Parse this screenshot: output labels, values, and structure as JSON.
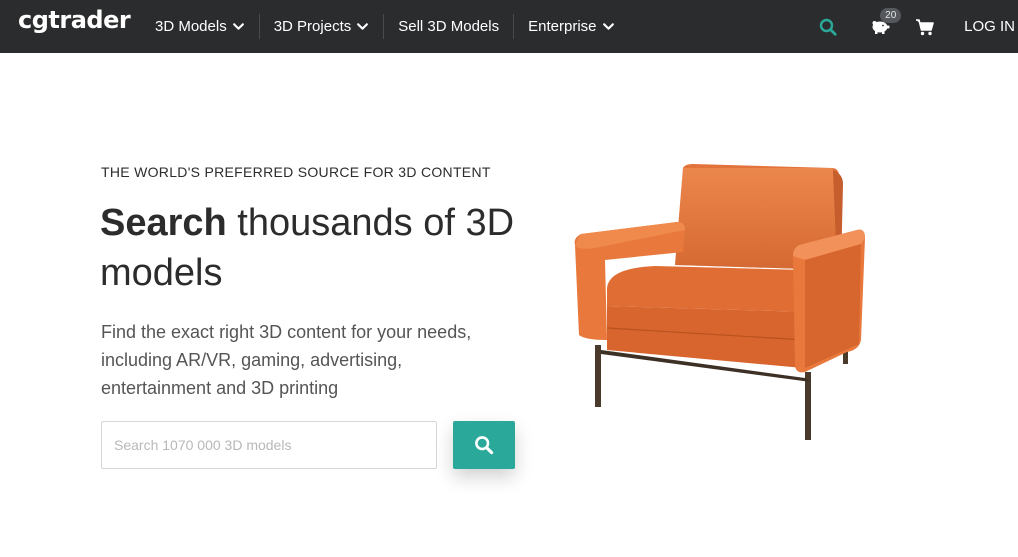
{
  "header": {
    "logo": "cgtrader",
    "nav": [
      {
        "label": "3D Models",
        "dropdown": true
      },
      {
        "label": "3D Projects",
        "dropdown": true
      },
      {
        "label": "Sell 3D Models",
        "dropdown": false
      },
      {
        "label": "Enterprise",
        "dropdown": true
      }
    ],
    "icons": {
      "search": "search-icon",
      "piggy_bank": "piggy-bank-icon",
      "cart": "cart-icon"
    },
    "piggy_badge": "20",
    "login_label": "LOG IN"
  },
  "hero": {
    "eyebrow": "THE WORLD'S PREFERRED SOURCE FOR 3D CONTENT",
    "headline_bold": "Search",
    "headline_rest": " thousands of 3D models",
    "subtext": "Find the exact right 3D content for your needs, including AR/VR, gaming, advertising, entertainment and 3D printing",
    "search_placeholder": "Search 1070 000 3D models",
    "search_value": "",
    "search_button_icon": "search-icon"
  },
  "colors": {
    "topbar": "#2b2c2e",
    "accent": "#2aa89a",
    "chair": "#e8743a"
  }
}
